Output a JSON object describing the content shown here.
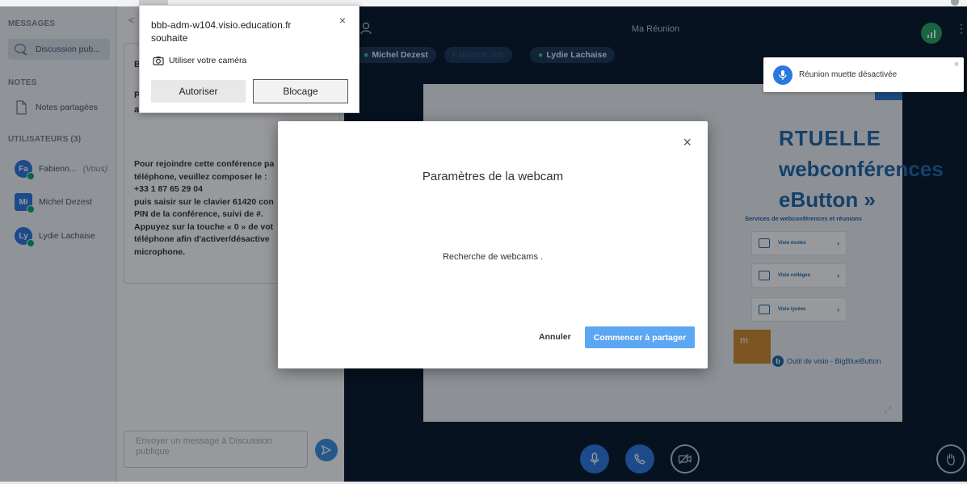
{
  "users_panel": {
    "messages_title": "MESSAGES",
    "public_chat": "Discussion pub...",
    "notes_title": "NOTES",
    "shared_notes": "Notes partagées",
    "users_title": "UTILISATEURS (3)",
    "users": [
      {
        "initials": "Fa",
        "name": "Fabienn...",
        "suffix": "(Vous)",
        "color": "#2b78e0"
      },
      {
        "initials": "Mi",
        "name": "Michel Dezest",
        "suffix": "",
        "color": "#2b78e0"
      },
      {
        "initials": "Ly",
        "name": "Lydie Lachaise",
        "suffix": "",
        "color": "#2b78e0"
      }
    ]
  },
  "chat": {
    "back_chevron": "<",
    "line1": "B",
    "line2": "P",
    "line3": "a",
    "dialin": "Pour rejoindre cette conférence pa\ntéléphone, veuillez composer le :\n+33 1 87 65 29 04\npuis saisir sur le clavier 61420 con\nPIN de la conférence, suivi de #.\nAppuyez sur la touche « 0 » de vot\ntéléphone afin d'activer/désactive\nmicrophone.",
    "input_placeholder": "Envoyer un message à Discussion publique"
  },
  "main": {
    "meeting_title": "Ma Réunion",
    "pills": [
      {
        "label": "Michel Dezest",
        "dim": false,
        "mic": true
      },
      {
        "label": "Fabienne Job",
        "dim": true,
        "mic": false
      },
      {
        "label": "Lydie Lachaise",
        "dim": false,
        "mic": true
      }
    ],
    "slide": {
      "title1": "RTUELLE",
      "title2": "webconférences",
      "title3": "eButton »",
      "subtitle": "Services de webconférences et réunions",
      "cards": [
        "Visio écoles",
        "Visio collèges",
        "Visio lycées"
      ],
      "logo_text": "m",
      "brand": "Outil de visio - BigBlueButton"
    }
  },
  "toast": {
    "text": "Réunion muette désactivée",
    "close": "×"
  },
  "modal": {
    "title": "Paramètres de la webcam",
    "body": "Recherche de webcams .",
    "cancel": "Annuler",
    "share": "Commencer à partager",
    "close": "×"
  },
  "permission": {
    "host": "bbb-adm-w104.visio.education.fr souhaite",
    "request": "Utiliser votre caméra",
    "allow": "Autoriser",
    "block": "Blocage",
    "close": "×"
  }
}
